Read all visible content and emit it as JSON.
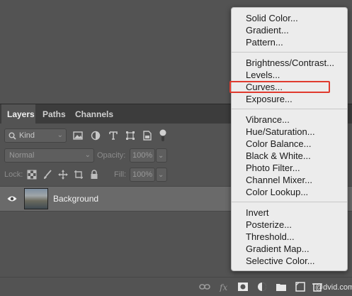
{
  "panel": {
    "tabs": [
      {
        "label": "Layers",
        "active": true
      },
      {
        "label": "Paths",
        "active": false
      },
      {
        "label": "Channels",
        "active": false
      }
    ],
    "filter": {
      "kind_label": "Kind",
      "icons": [
        "image-filter-icon",
        "adjustment-filter-icon",
        "type-filter-icon",
        "shape-filter-icon",
        "smart-object-filter-icon",
        "filter-toggle-icon"
      ]
    },
    "blend_mode": "Normal",
    "opacity_label": "Opacity:",
    "opacity_value": "100%",
    "lock_label": "Lock:",
    "fill_label": "Fill:",
    "fill_value": "100%",
    "layer": {
      "name": "Background"
    }
  },
  "bottom_icons": [
    "link-icon",
    "fx-icon",
    "mask-icon",
    "adjustment-layer-icon",
    "folder-icon",
    "new-layer-icon",
    "trash-icon"
  ],
  "menu": {
    "groups": [
      [
        "Solid Color...",
        "Gradient...",
        "Pattern..."
      ],
      [
        "Brightness/Contrast...",
        "Levels...",
        "Curves...",
        "Exposure..."
      ],
      [
        "Vibrance...",
        "Hue/Saturation...",
        "Color Balance...",
        "Black & White...",
        "Photo Filter...",
        "Channel Mixer...",
        "Color Lookup..."
      ],
      [
        "Invert",
        "Posterize...",
        "Threshold...",
        "Gradient Map...",
        "Selective Color..."
      ]
    ],
    "highlighted": "Curves...",
    "highlight_color": "#e03a2e"
  },
  "watermark": "@dvid.com"
}
